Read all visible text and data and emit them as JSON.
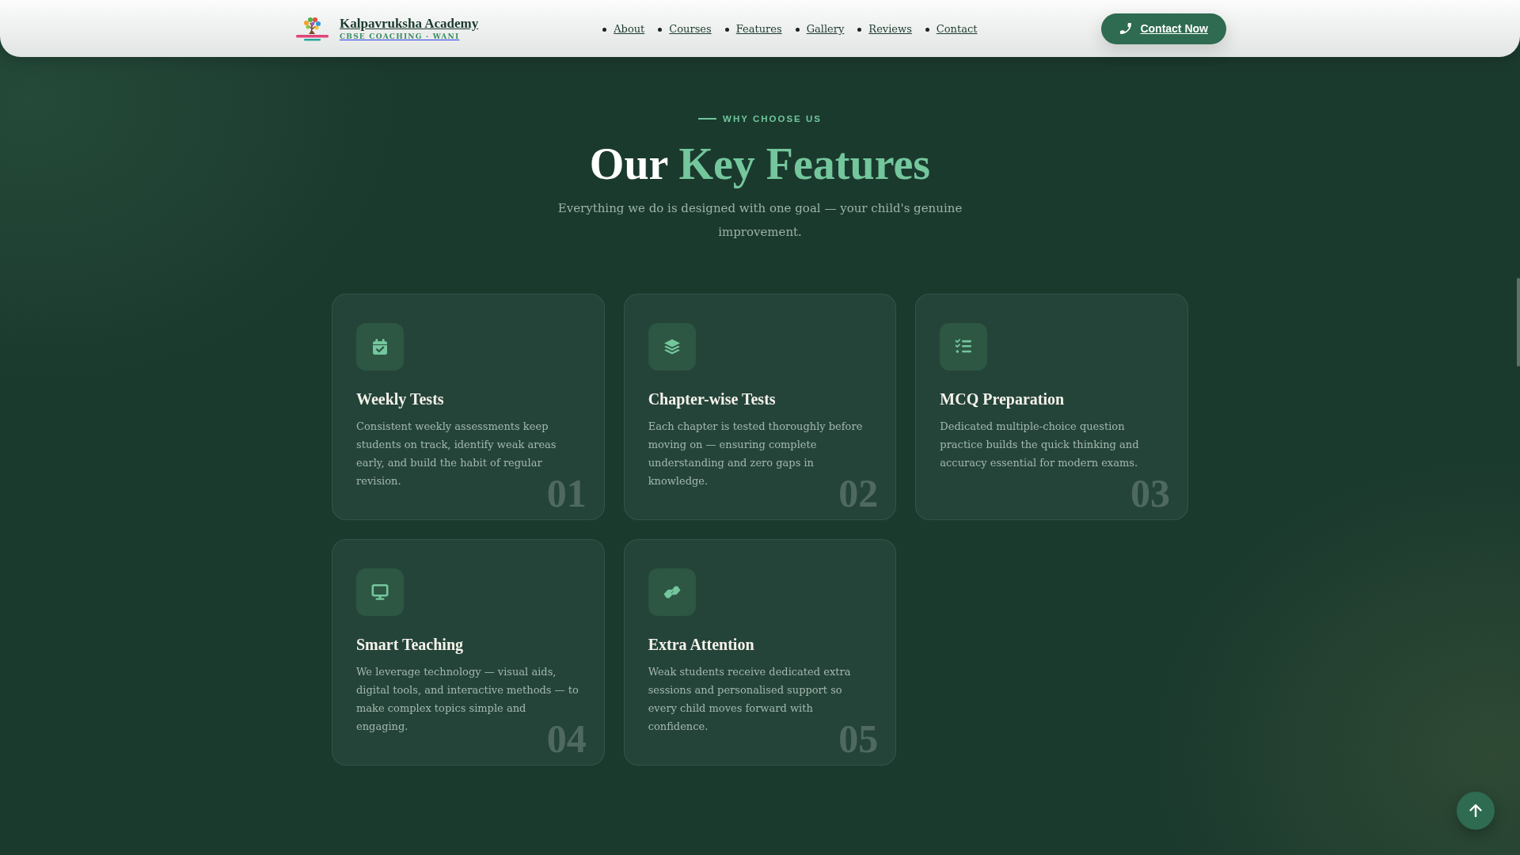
{
  "header": {
    "brand": {
      "name": "Kalpavruksha Academy",
      "tagline": "CBSE COACHING · WANI"
    },
    "nav": [
      "About",
      "Courses",
      "Features",
      "Gallery",
      "Reviews",
      "Contact"
    ],
    "cta": "Contact Now"
  },
  "section": {
    "eyebrow": "WHY CHOOSE US",
    "title": {
      "lead": "Our",
      "highlight": "Key Features"
    },
    "subtitle": "Everything we do is designed with one goal — your child's genuine improvement.",
    "features": [
      {
        "number": "01",
        "title": "Weekly Tests",
        "description": "Consistent weekly assessments keep students on track, identify weak areas early, and build the habit of regular revision."
      },
      {
        "number": "02",
        "title": "Chapter-wise Tests",
        "description": "Each chapter is tested thoroughly before moving on — ensuring complete understanding and zero gaps in knowledge."
      },
      {
        "number": "03",
        "title": "MCQ Preparation",
        "description": "Dedicated multiple-choice question practice builds the quick thinking and accuracy essential for modern exams."
      },
      {
        "number": "04",
        "title": "Smart Teaching",
        "description": "We leverage technology — visual aids, digital tools, and interactive methods — to make complex topics simple and engaging."
      },
      {
        "number": "05",
        "title": "Extra Attention",
        "description": "Weak students receive dedicated extra sessions and personalised support so every child moves forward with confidence."
      }
    ]
  }
}
